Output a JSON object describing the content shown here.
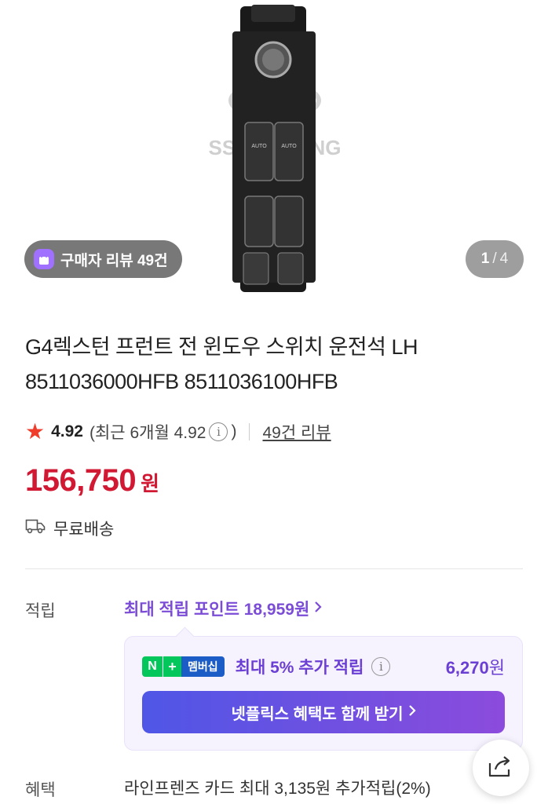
{
  "gallery": {
    "review_pill": "구매자 리뷰 49건",
    "current": "1",
    "divider": "/",
    "total": "4",
    "watermark": "SSANGYONG",
    "auto_label": "AUTO"
  },
  "product": {
    "title": "G4렉스턴 프런트 전 윈도우 스위치 운전석 LH 8511036000HFB 8511036100HFB",
    "rating": "4.92",
    "rating_recent_prefix": "(최근 6개월 4.92",
    "rating_recent_suffix": ")",
    "review_link": "49건 리뷰",
    "price": "156,750",
    "price_unit": "원",
    "shipping": "무료배송"
  },
  "points": {
    "label": "적립",
    "max_points": "최대 적립 포인트 18,959원",
    "membership_n": "N",
    "membership_plus": "+",
    "membership_tag": "멤버십",
    "membership_text": "최대 5% 추가 적립",
    "membership_amount": "6,270",
    "membership_unit": "원",
    "netflix_button": "넷플릭스 혜택도 함께 받기"
  },
  "benefit": {
    "label": "혜택",
    "card_text": "라인프렌즈 카드 최대 3,135원 추가적립(2%)"
  },
  "colors": {
    "price": "#d11934",
    "accent_purple": "#7b4cd6",
    "star": "#f03c2a",
    "naver_green": "#03c75a"
  }
}
